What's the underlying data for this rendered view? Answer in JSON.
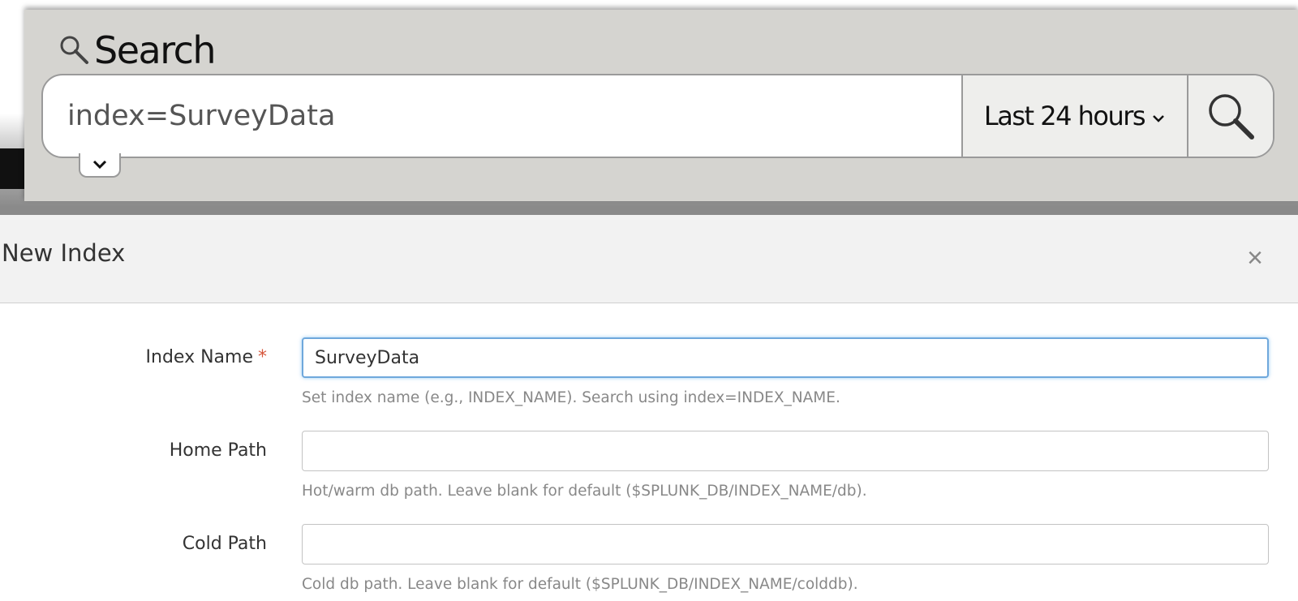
{
  "search": {
    "title": "Search",
    "query": "index=SurveyData",
    "time_range": "Last 24 hours"
  },
  "modal": {
    "title": "New Index",
    "close_symbol": "×",
    "fields": [
      {
        "label": "Index Name",
        "required_marker": "*",
        "value": "SurveyData",
        "help": "Set index name (e.g., INDEX_NAME). Search using index=INDEX_NAME."
      },
      {
        "label": "Home Path",
        "value": "",
        "help": "Hot/warm db path. Leave blank for default ($SPLUNK_DB/INDEX_NAME/db)."
      },
      {
        "label": "Cold Path",
        "value": "",
        "help": "Cold db path. Leave blank for default ($SPLUNK_DB/INDEX_NAME/colddb)."
      }
    ]
  },
  "colors": {
    "search_panel": "#d5d4d0",
    "focus_ring": "#6fa8dc",
    "required": "#d6563c"
  },
  "icons": {
    "title": "magnifier-icon",
    "submit": "magnifier-icon",
    "time_picker": "chevron-down-icon",
    "expand": "chevron-down-icon"
  }
}
